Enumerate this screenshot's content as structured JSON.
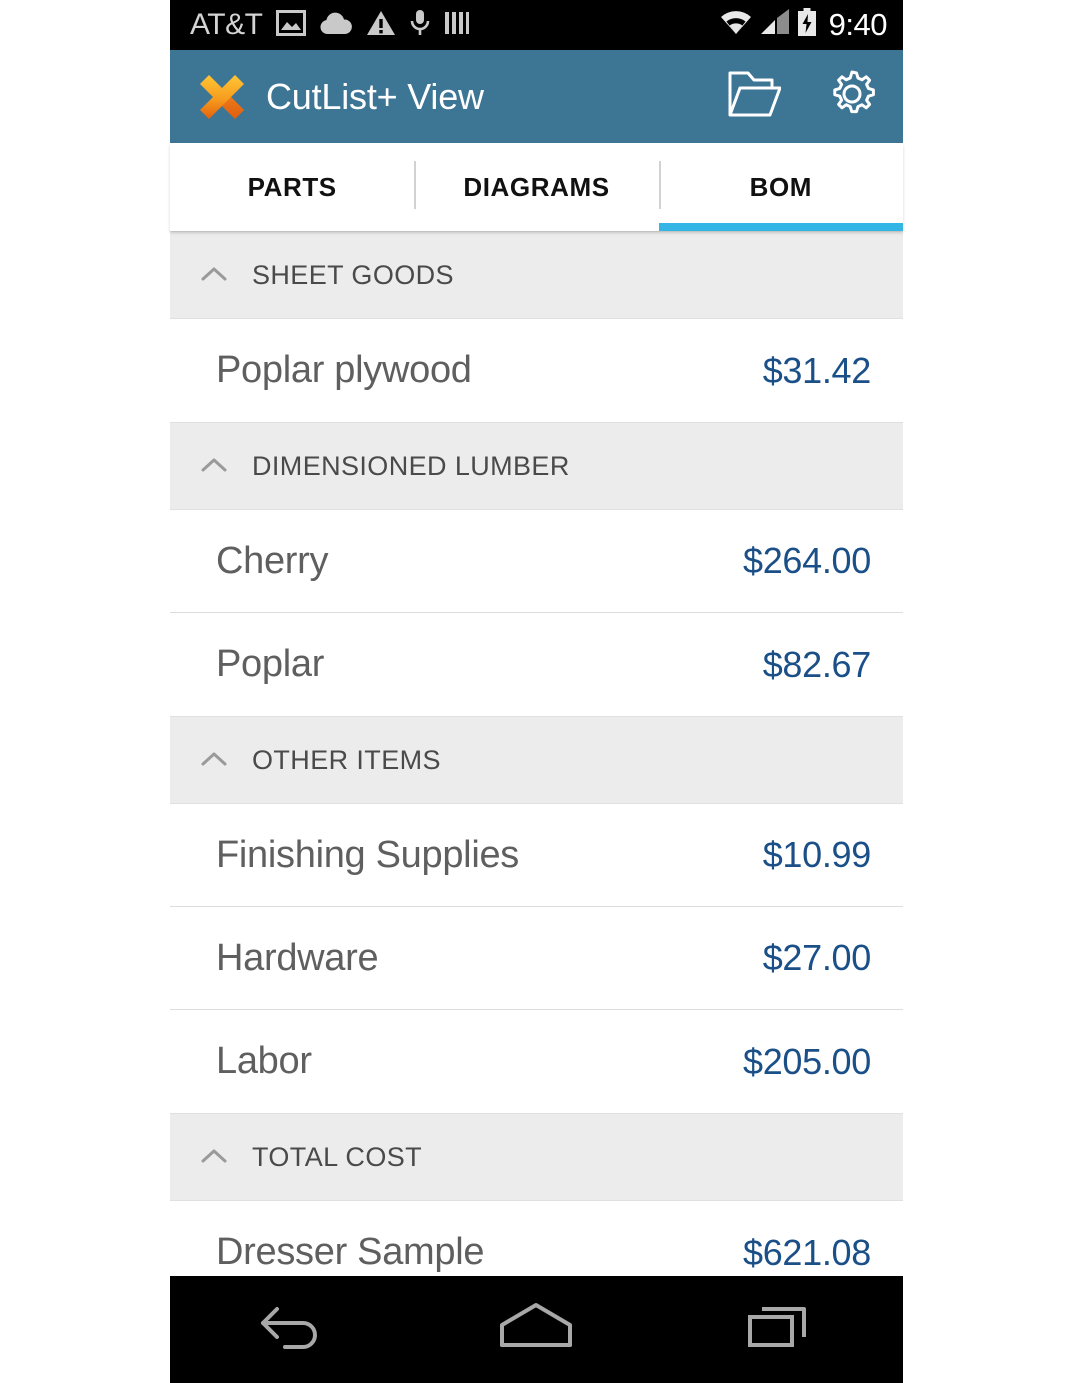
{
  "status_bar": {
    "carrier": "AT&T",
    "clock": "9:40",
    "left_icons": [
      "image-icon",
      "cloud-upload-icon",
      "warning-icon",
      "microphone-icon",
      "bars-icon"
    ],
    "right_icons": [
      "wifi-icon",
      "cell-signal-icon",
      "battery-charging-icon"
    ]
  },
  "app_bar": {
    "logo": "cutlist-x-logo",
    "title": "CutList+ View",
    "actions": [
      {
        "name": "open-folder-button",
        "icon": "folder-open-icon"
      },
      {
        "name": "settings-button",
        "icon": "gear-icon"
      }
    ]
  },
  "tabs": {
    "items": [
      {
        "label": "PARTS",
        "active": false
      },
      {
        "label": "DIAGRAMS",
        "active": false
      },
      {
        "label": "BOM",
        "active": true
      }
    ],
    "active_index": 2,
    "indicator_color": "#33b5e5"
  },
  "bom": {
    "sections": [
      {
        "title": "SHEET GOODS",
        "collapse_icon": "chevron-up-icon",
        "rows": [
          {
            "name": "Poplar plywood",
            "value": "$31.42"
          }
        ]
      },
      {
        "title": "DIMENSIONED LUMBER",
        "collapse_icon": "chevron-up-icon",
        "rows": [
          {
            "name": "Cherry",
            "value": "$264.00"
          },
          {
            "name": "Poplar",
            "value": "$82.67"
          }
        ]
      },
      {
        "title": "OTHER ITEMS",
        "collapse_icon": "chevron-up-icon",
        "rows": [
          {
            "name": "Finishing Supplies",
            "value": "$10.99"
          },
          {
            "name": "Hardware",
            "value": "$27.00"
          },
          {
            "name": "Labor",
            "value": "$205.00"
          }
        ]
      },
      {
        "title": "TOTAL COST",
        "collapse_icon": "chevron-up-icon",
        "rows": [
          {
            "name": "Dresser Sample",
            "value": "$621.08"
          }
        ]
      }
    ]
  },
  "nav_bar": {
    "buttons": [
      {
        "name": "back-button",
        "icon": "back-arrow-icon"
      },
      {
        "name": "home-button",
        "icon": "home-icon"
      },
      {
        "name": "recents-button",
        "icon": "recents-icon"
      }
    ]
  },
  "colors": {
    "app_bar": "#3d7595",
    "tab_indicator": "#33b5e5",
    "price_text": "#1a4f87",
    "section_bg": "#ececec",
    "row_text": "#5f5f5f"
  }
}
